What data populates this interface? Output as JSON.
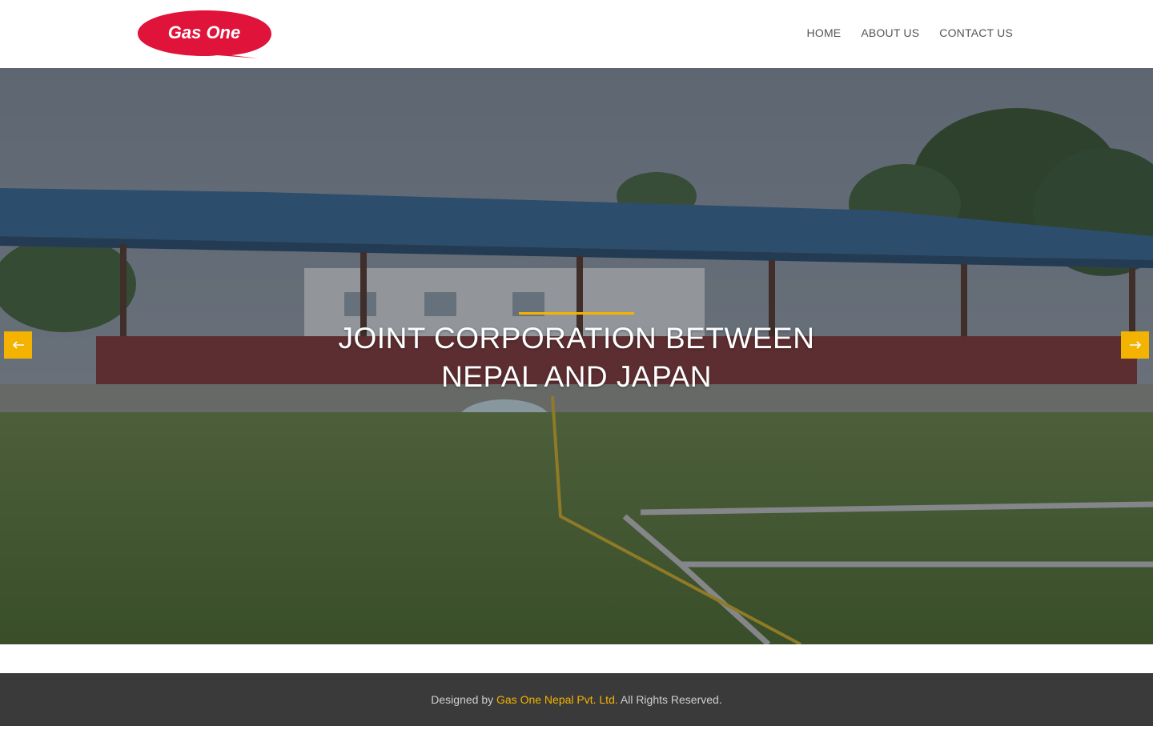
{
  "brand": {
    "logo_text": "Gas One",
    "logo_color": "#e0133a"
  },
  "nav": {
    "items": [
      {
        "label": "HOME"
      },
      {
        "label": "ABOUT US"
      },
      {
        "label": "CONTACT US"
      }
    ]
  },
  "hero": {
    "heading": "JOINT CORPORATION BETWEEN NEPAL AND JAPAN",
    "accent_color": "#f5b301",
    "prev_icon": "arrow-left-icon",
    "next_icon": "arrow-right-icon"
  },
  "footer": {
    "prefix": "Designed by",
    "company": "Gas One Nepal Pvt. Ltd.",
    "suffix": "All Rights Reserved."
  }
}
